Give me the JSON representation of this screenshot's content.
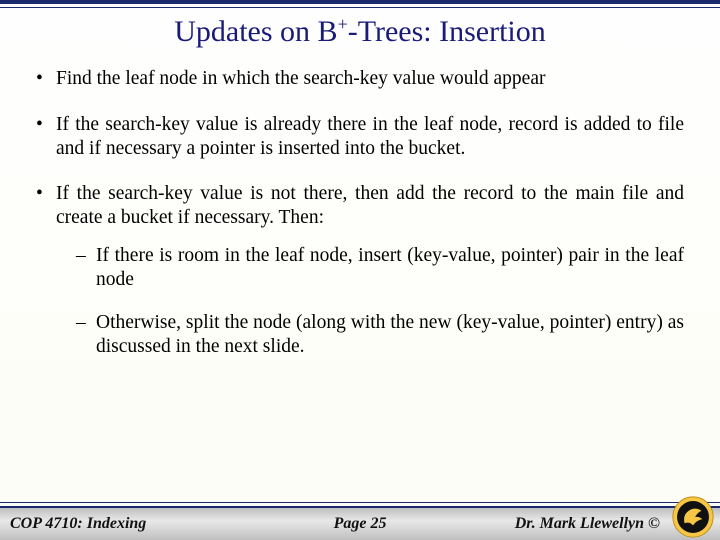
{
  "title": {
    "pre": "Updates on B",
    "sup": "+",
    "post": "-Trees:  Insertion"
  },
  "bullets": {
    "b1": "Find the leaf node in which the search-key value would appear",
    "b2": "If the search-key value is already there in the leaf node, record is added to file and if necessary a pointer is inserted into the bucket.",
    "b3": "If the search-key value is not there, then add the record to the main file and create a bucket if necessary.  Then:",
    "s1": "If there is room in the leaf node, insert (key-value, pointer) pair in the leaf node",
    "s2": "Otherwise, split the node (along with the new (key-value, pointer) entry) as discussed in the next slide."
  },
  "footer": {
    "left": "COP 4710: Indexing",
    "center": "Page 25",
    "right": "Dr. Mark Llewellyn ©"
  }
}
